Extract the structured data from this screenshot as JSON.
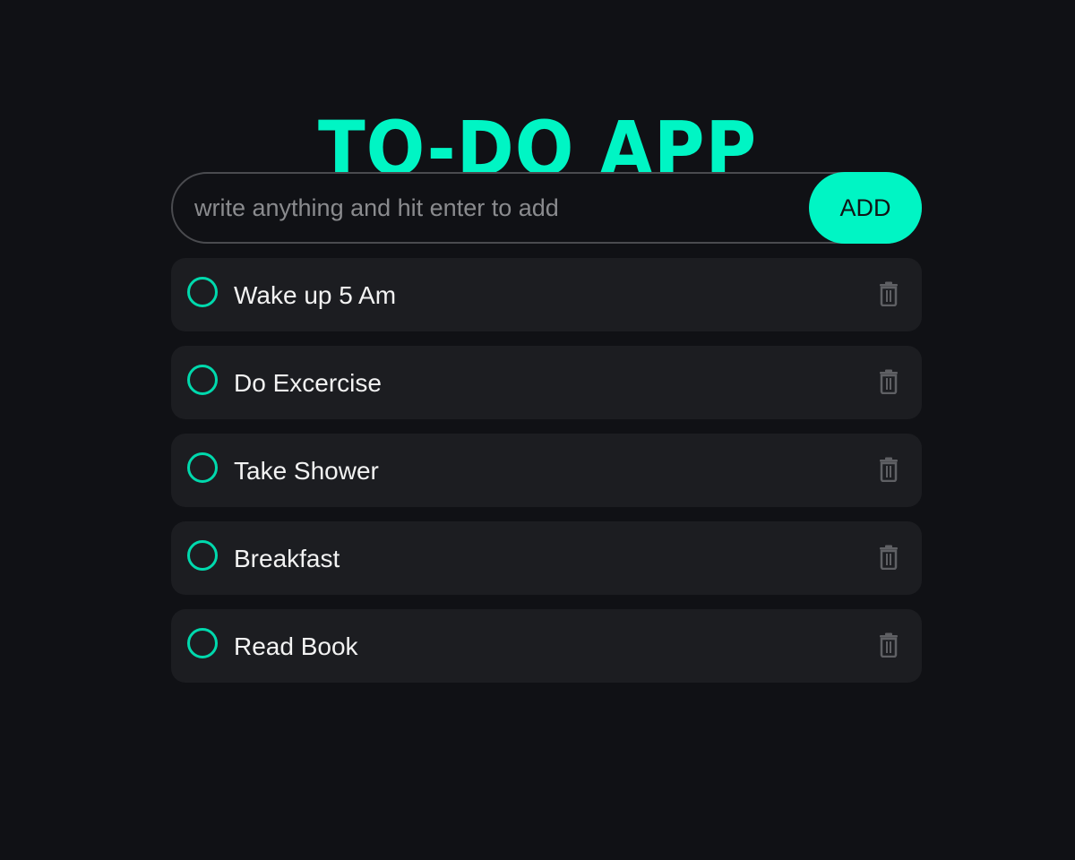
{
  "app": {
    "title": "TO-DO APP",
    "accent_color": "#00f5c4",
    "background_color": "#101115"
  },
  "input": {
    "placeholder": "write anything and hit enter to add",
    "value": "",
    "add_label": "ADD"
  },
  "todos": [
    {
      "text": "Wake up 5 Am",
      "done": false,
      "delete_icon": "trash-icon"
    },
    {
      "text": "Do Excercise",
      "done": false,
      "delete_icon": "trash-icon"
    },
    {
      "text": "Take Shower",
      "done": false,
      "delete_icon": "trash-icon"
    },
    {
      "text": "Breakfast",
      "done": false,
      "delete_icon": "trash-icon"
    },
    {
      "text": "Read Book",
      "done": false,
      "delete_icon": "trash-icon"
    }
  ]
}
